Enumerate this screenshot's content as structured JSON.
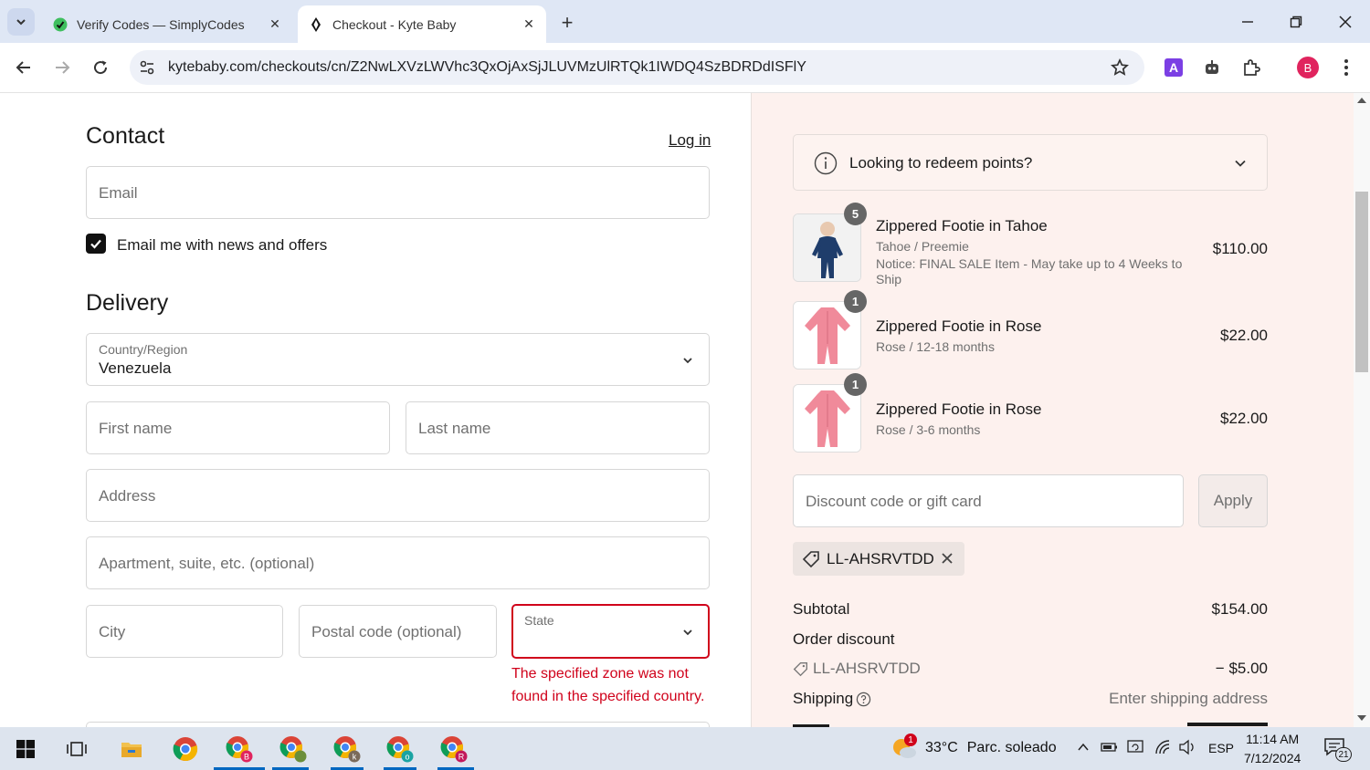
{
  "browser": {
    "tabs": [
      {
        "title": "Verify Codes — SimplyCodes",
        "active": false
      },
      {
        "title": "Checkout - Kyte Baby",
        "active": true
      }
    ],
    "url": "kytebaby.com/checkouts/cn/Z2NwLXVzLWVhc3QxOjAxSjJLUVMzUlRTQk1IWDQ4SzBDRDdISFlY",
    "profile_initial": "B",
    "ext_badge": "A"
  },
  "contact": {
    "heading": "Contact",
    "login_link": "Log in",
    "email_placeholder": "Email",
    "newsletter_label": "Email me with news and offers",
    "newsletter_checked": true
  },
  "delivery": {
    "heading": "Delivery",
    "country_label": "Country/Region",
    "country_value": "Venezuela",
    "first_name_placeholder": "First name",
    "last_name_placeholder": "Last name",
    "address_placeholder": "Address",
    "apartment_placeholder": "Apartment, suite, etc. (optional)",
    "city_placeholder": "City",
    "postal_placeholder": "Postal code (optional)",
    "state_label": "State",
    "state_error": "The specified zone was not found in the specified country."
  },
  "summary": {
    "redeem_text": "Looking to redeem points?",
    "items": [
      {
        "qty": "5",
        "name": "Zippered Footie in Tahoe",
        "variant": "Tahoe / Preemie",
        "note": "Notice: FINAL SALE Item - May take up to 4 Weeks to Ship",
        "price": "$110.00",
        "color": "navy"
      },
      {
        "qty": "1",
        "name": "Zippered Footie in Rose",
        "variant": "Rose / 12-18 months",
        "note": "",
        "price": "$22.00",
        "color": "rose"
      },
      {
        "qty": "1",
        "name": "Zippered Footie in Rose",
        "variant": "Rose / 3-6 months",
        "note": "",
        "price": "$22.00",
        "color": "rose"
      }
    ],
    "discount_placeholder": "Discount code or gift card",
    "apply_label": "Apply",
    "applied_code": "LL-AHSRVTDD",
    "subtotal_label": "Subtotal",
    "subtotal_value": "$154.00",
    "order_discount_label": "Order discount",
    "discount_code": "LL-AHSRVTDD",
    "discount_value": "− $5.00",
    "shipping_label": "Shipping",
    "shipping_value": "Enter shipping address"
  },
  "taskbar": {
    "weather_temp": "33°C",
    "weather_desc": "Parc. soleado",
    "weather_badge": "1",
    "language": "ESP",
    "time": "11:14 AM",
    "date": "7/12/2024",
    "notifications": "21"
  },
  "colors": {
    "accent_error": "#d0021b",
    "summary_bg": "#fdf1ee",
    "tabbar_bg": "#dfe7f5"
  }
}
